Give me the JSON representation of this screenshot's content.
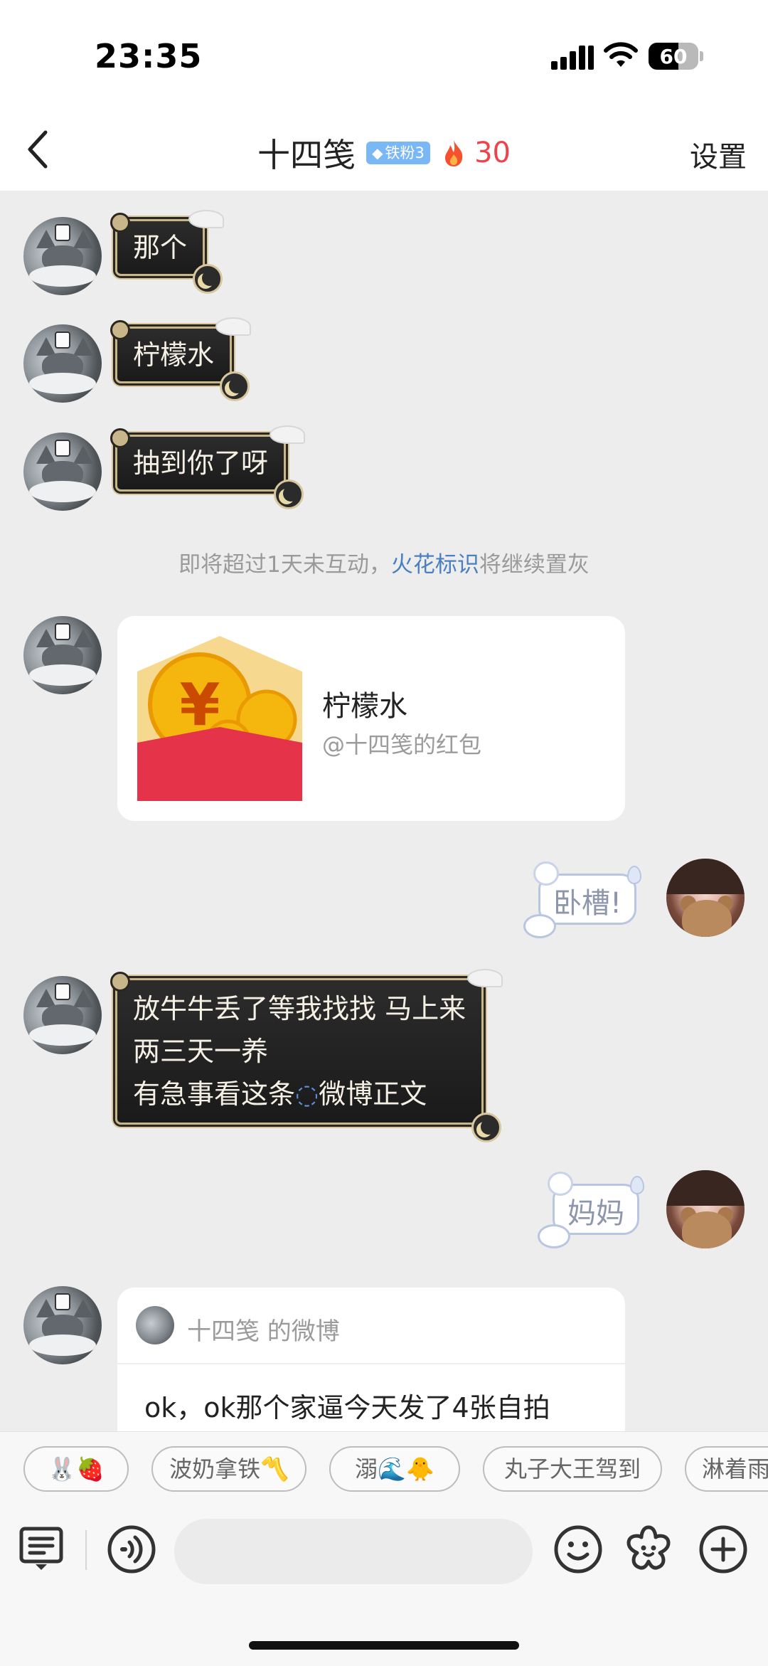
{
  "status_bar": {
    "time": "23:35",
    "battery": "60",
    "battery_level": 0.6
  },
  "nav": {
    "title": "十四笺",
    "fan_badge": "铁粉3",
    "spark_count": "30",
    "settings": "设置"
  },
  "messages": [
    {
      "side": "left",
      "style": "dark",
      "text": "那个"
    },
    {
      "side": "left",
      "style": "dark",
      "text": "柠檬水"
    },
    {
      "side": "left",
      "style": "dark",
      "text": "抽到你了呀"
    }
  ],
  "system_tip": {
    "before": "即将超过1天未互动，",
    "link": "火花标识",
    "after": "将继续置灰"
  },
  "red_packet": {
    "title": "柠檬水",
    "subtitle": "@十四笺的红包"
  },
  "reply_1": "卧槽!",
  "long_message": {
    "line1": "放牛牛丢了等我找找 马上来",
    "line2": "两三天一养",
    "line3_prefix": "有急事看这条",
    "line3_link": "微博正文"
  },
  "reply_2": "妈妈",
  "weibo_card": {
    "header": "十四笺 的微博",
    "body": "ok，ok那个家逼今天发了4张自拍"
  },
  "quick_replies": [
    "🐰🍓",
    "波奶拿铁〽️",
    "溺🌊🐥",
    "丸子大王驾到",
    "淋着雨"
  ],
  "icons": {
    "back": "chevron-left-icon",
    "flame": "flame-icon",
    "menu": "keyboard-menu-icon",
    "voice": "voice-icon",
    "emoji": "emoji-icon",
    "sticker": "flower-sticker-icon",
    "plus": "plus-icon"
  },
  "colors": {
    "spark": "#f0424c",
    "link": "#4a7fc1",
    "red_packet": "#e5344a",
    "coin": "#f5b60d"
  }
}
